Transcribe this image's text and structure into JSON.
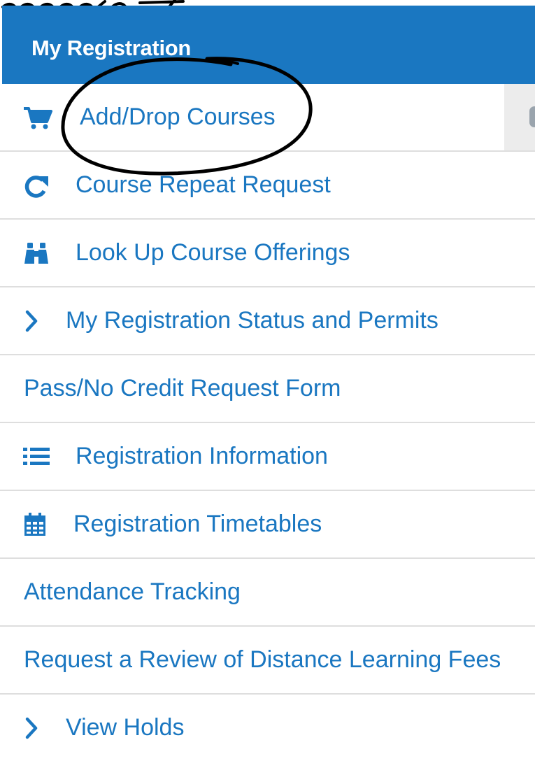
{
  "header": {
    "title": "My Registration"
  },
  "menu": [
    {
      "label": "Add/Drop Courses",
      "icon": "shopping-cart-icon"
    },
    {
      "label": "Course Repeat Request",
      "icon": "redo-icon"
    },
    {
      "label": "Look Up Course Offerings",
      "icon": "binoculars-icon"
    },
    {
      "label": "My Registration Status and Permits",
      "icon": "chevron-right-icon"
    },
    {
      "label": "Pass/No Credit Request Form",
      "icon": ""
    },
    {
      "label": "Registration Information",
      "icon": "list-icon"
    },
    {
      "label": "Registration Timetables",
      "icon": "calendar-icon"
    },
    {
      "label": "Attendance Tracking",
      "icon": ""
    },
    {
      "label": "Request a Review of Distance Learning Fees",
      "icon": ""
    },
    {
      "label": "View Holds",
      "icon": "chevron-right-icon"
    }
  ],
  "colors": {
    "header_bg": "#1a77c1",
    "link": "#1a77c1",
    "divider": "#dedede"
  }
}
